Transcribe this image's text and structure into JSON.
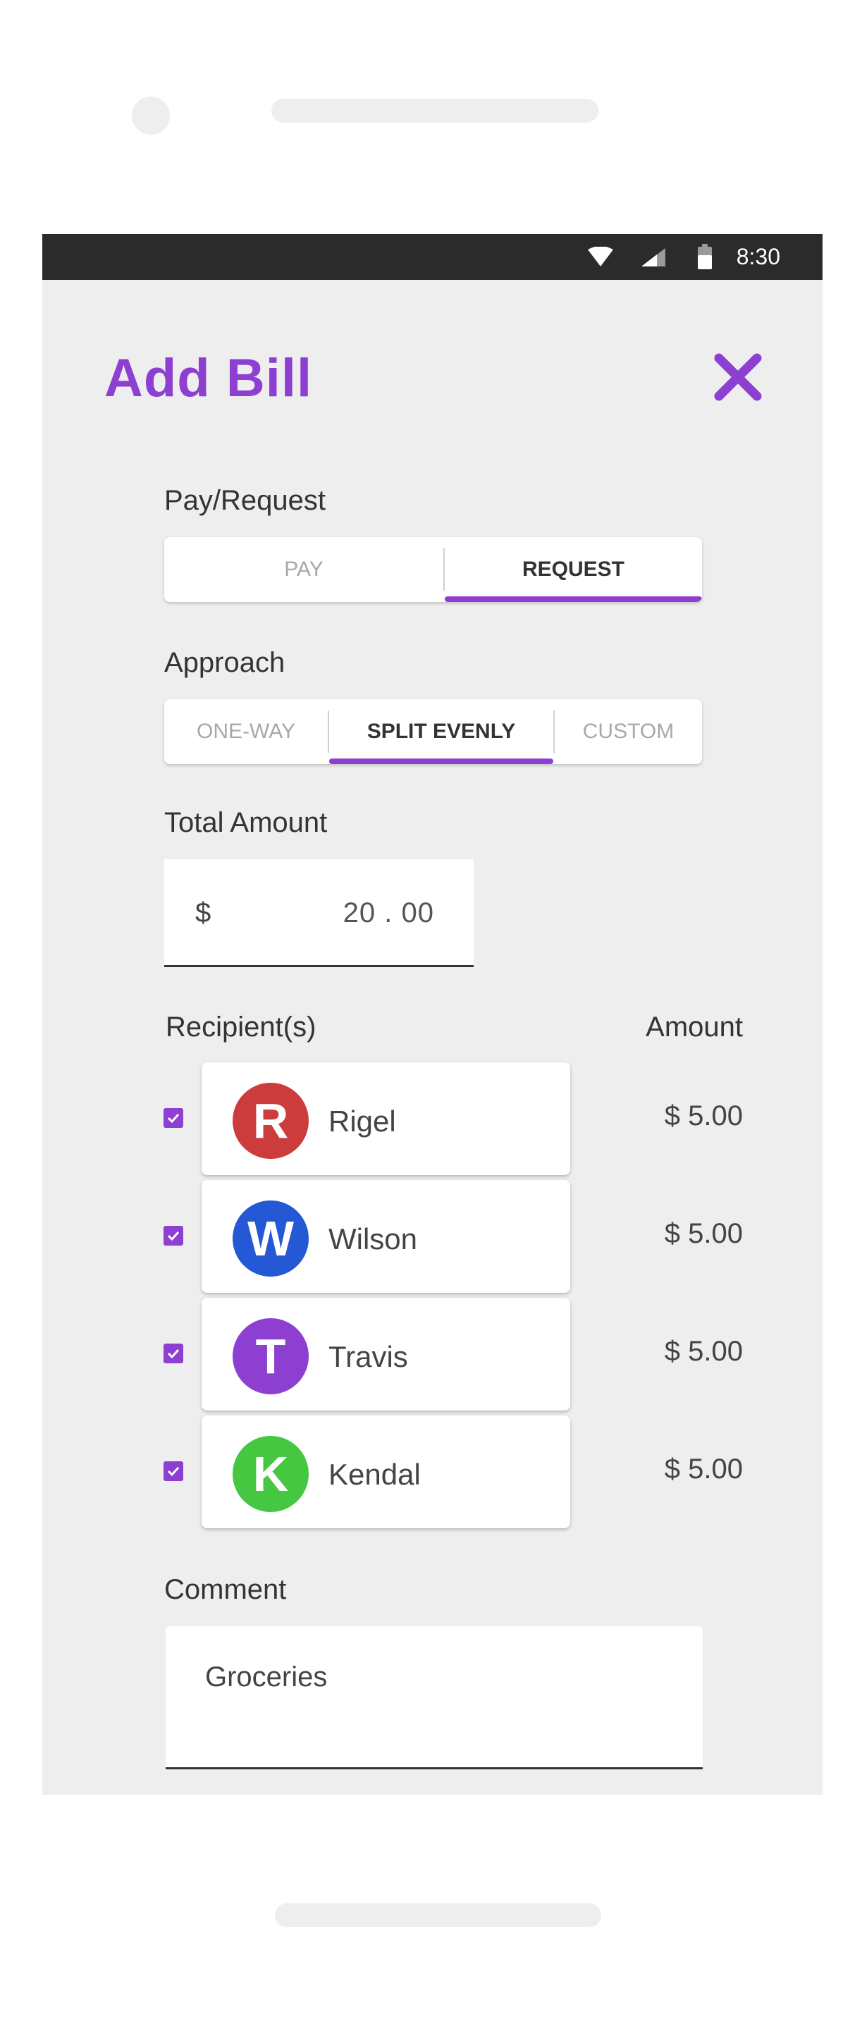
{
  "status_bar": {
    "time": "8:30",
    "icons": [
      "wifi-icon",
      "signal-icon",
      "battery-icon"
    ]
  },
  "header": {
    "title": "Add Bill",
    "close_icon": "close-icon"
  },
  "pay_request": {
    "label": "Pay/Request",
    "options": [
      "PAY",
      "REQUEST"
    ],
    "selected": "REQUEST"
  },
  "approach": {
    "label": "Approach",
    "options": [
      "ONE-WAY",
      "SPLIT EVENLY",
      "CUSTOM"
    ],
    "selected": "SPLIT EVENLY"
  },
  "total_amount": {
    "label": "Total Amount",
    "currency": "$",
    "value": "20 . 00"
  },
  "recipients": {
    "header_label": "Recipient(s)",
    "amount_label": "Amount",
    "items": [
      {
        "initial": "R",
        "name": "Rigel",
        "amount": "$ 5.00",
        "checked": true,
        "color": "#cc3c3c"
      },
      {
        "initial": "W",
        "name": "Wilson",
        "amount": "$ 5.00",
        "checked": true,
        "color": "#2458d4"
      },
      {
        "initial": "T",
        "name": "Travis",
        "amount": "$ 5.00",
        "checked": true,
        "color": "#8d3fd1"
      },
      {
        "initial": "K",
        "name": "Kendal",
        "amount": "$ 5.00",
        "checked": true,
        "color": "#45c742"
      }
    ]
  },
  "comment": {
    "label": "Comment",
    "value": "Groceries"
  },
  "colors": {
    "accent": "#8d3fd1",
    "background": "#eeeeee",
    "status_bar": "#2b2b2b"
  }
}
